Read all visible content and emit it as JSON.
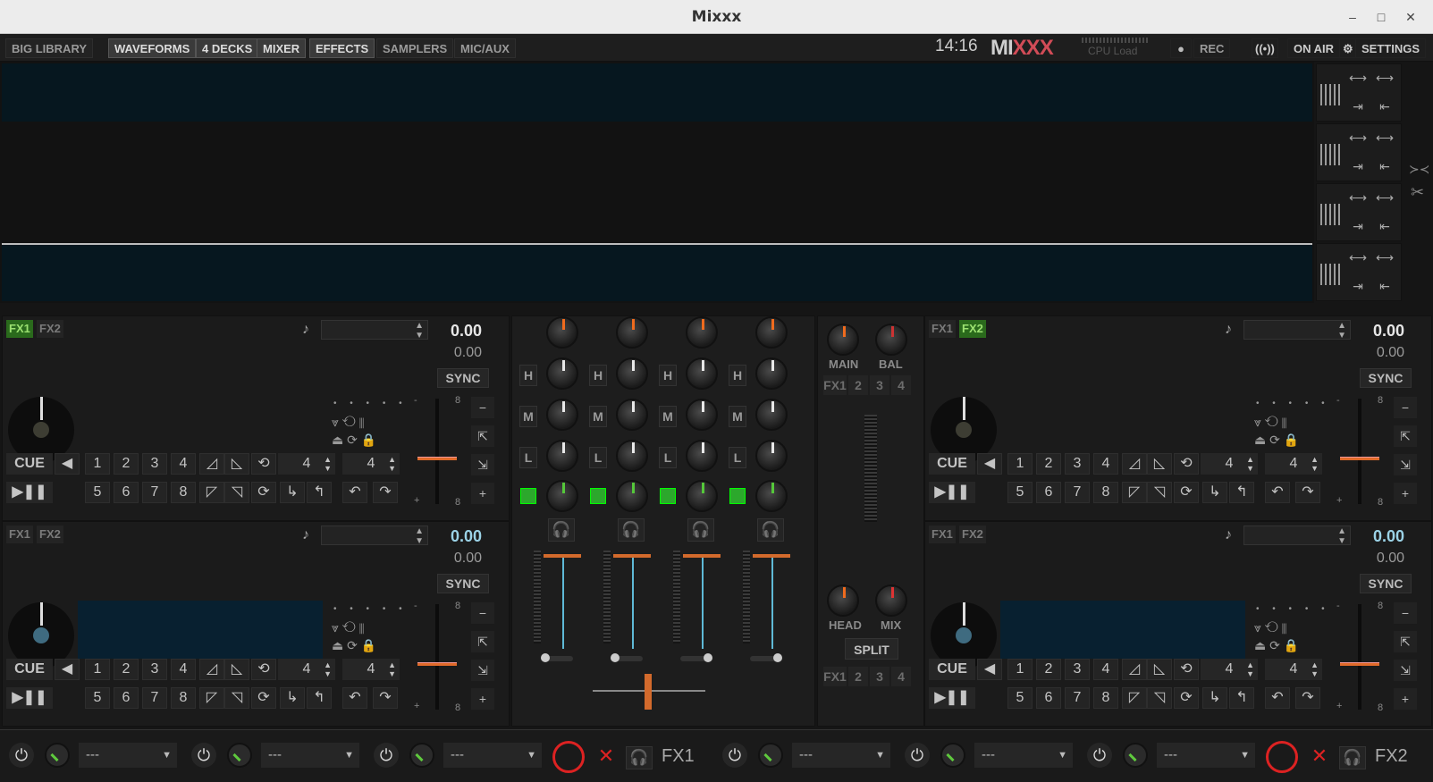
{
  "window": {
    "title": "Mixxx",
    "minimize": "–",
    "maximize": "□",
    "close": "✕"
  },
  "topbar": {
    "buttons": [
      "BIG LIBRARY",
      "WAVEFORMS",
      "4 DECKS",
      "MIXER",
      "EFFECTS",
      "SAMPLERS",
      "MIC/AUX"
    ],
    "active": [
      "WAVEFORMS",
      "4 DECKS",
      "MIXER",
      "EFFECTS"
    ],
    "clock": "14:16",
    "logo": "MIXXX",
    "cpu_label": "CPU Load",
    "rec": "REC",
    "rec_icon": "●",
    "on_air": "ON AIR",
    "on_air_icon": "((•))",
    "settings": "SETTINGS",
    "settings_icon": "⚙"
  },
  "decks": [
    {
      "fx1": "FX1",
      "fx2": "FX2",
      "fx1_on": true,
      "fx2_on": false,
      "note": "♪",
      "bpm": "0.00",
      "rate": "0.00",
      "sync": "SYNC",
      "cue": "CUE",
      "hotcues": [
        "1",
        "2",
        "3",
        "4",
        "5",
        "6",
        "7",
        "8"
      ],
      "loop_a": "4",
      "loop_b": "4",
      "pitch_top": "8",
      "pitch_bottom": "8",
      "bpm_color": "white"
    },
    {
      "fx1": "FX1",
      "fx2": "FX2",
      "fx1_on": false,
      "fx2_on": true,
      "note": "♪",
      "bpm": "0.00",
      "rate": "0.00",
      "sync": "SYNC",
      "cue": "CUE",
      "hotcues": [
        "1",
        "2",
        "3",
        "4",
        "5",
        "6",
        "7",
        "8"
      ],
      "loop_a": "4",
      "loop_b": "4",
      "pitch_top": "8",
      "pitch_bottom": "8",
      "bpm_color": "white"
    },
    {
      "fx1": "FX1",
      "fx2": "FX2",
      "fx1_on": false,
      "fx2_on": false,
      "note": "♪",
      "bpm": "0.00",
      "rate": "0.00",
      "sync": "SYNC",
      "cue": "CUE",
      "hotcues": [
        "1",
        "2",
        "3",
        "4",
        "5",
        "6",
        "7",
        "8"
      ],
      "loop_a": "4",
      "loop_b": "4",
      "pitch_top": "8",
      "pitch_bottom": "8",
      "bpm_color": "blue"
    },
    {
      "fx1": "FX1",
      "fx2": "FX2",
      "fx1_on": false,
      "fx2_on": false,
      "note": "♪",
      "bpm": "0.00",
      "rate": "0.00",
      "sync": "SYNC",
      "cue": "CUE",
      "hotcues": [
        "1",
        "2",
        "3",
        "4",
        "5",
        "6",
        "7",
        "8"
      ],
      "loop_a": "4",
      "loop_b": "4",
      "pitch_top": "8",
      "pitch_bottom": "8",
      "bpm_color": "blue"
    }
  ],
  "mixer": {
    "eq_labels": [
      "H",
      "M",
      "L"
    ],
    "channels": 4,
    "headphone_icon": "🎧"
  },
  "master": {
    "main": "MAIN",
    "bal": "BAL",
    "head": "HEAD",
    "mix": "MIX",
    "split": "SPLIT",
    "fx_assign": [
      "FX1",
      "2",
      "3",
      "4"
    ]
  },
  "effects": {
    "fx1_label": "FX1",
    "fx2_label": "FX2",
    "slot_value": "---",
    "power_icon": "⏻"
  },
  "colors": {
    "accent": "#ef6b1e",
    "fx_on": "#2a6a1c",
    "waveform": "#06171f",
    "cyan": "#5fb9d6"
  }
}
